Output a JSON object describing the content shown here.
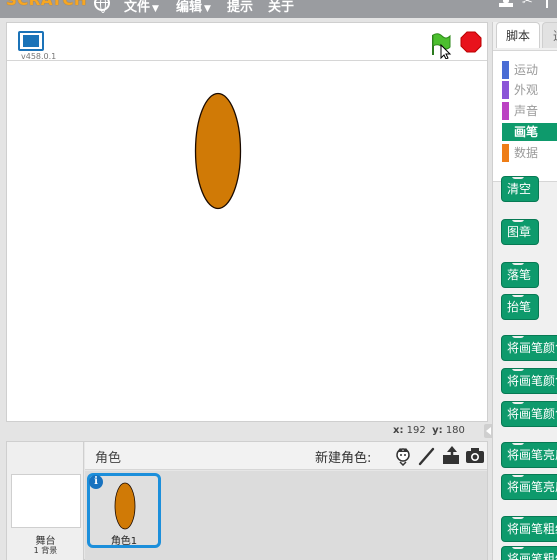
{
  "menubar": {
    "logo": "SCRATCH",
    "items": [
      {
        "label": "文件",
        "has_caret": true
      },
      {
        "label": "编辑",
        "has_caret": true
      },
      {
        "label": "提示",
        "has_caret": false
      },
      {
        "label": "关于",
        "has_caret": false
      }
    ],
    "caret": "▼",
    "tools": [
      "stamp-icon",
      "scissors-icon",
      "grow-icon"
    ]
  },
  "stage": {
    "version": "v458.0.1",
    "sprite_color": "#d07a06"
  },
  "coords": {
    "x_label": "x:",
    "x_value": "192",
    "y_label": "y:",
    "y_value": "180"
  },
  "sprites_panel": {
    "stage_label": "舞台",
    "backdrop_count": "1 背景",
    "title": "角色",
    "new_sprite_label": "新建角色:",
    "new_sprite_icons": [
      "sprite-library-icon",
      "paint-brush-icon",
      "upload-icon",
      "camera-icon"
    ],
    "sprites": [
      {
        "name": "角色1",
        "info": "i",
        "selected": true
      }
    ]
  },
  "palette": {
    "tabs": [
      {
        "label": "脚本",
        "active": true
      },
      {
        "label": "造型",
        "active": false
      }
    ],
    "categories": [
      {
        "label": "运动",
        "color": "#4a6cd4",
        "active": false
      },
      {
        "label": "外观",
        "color": "#8a55d7",
        "active": false
      },
      {
        "label": "声音",
        "color": "#bb42c3",
        "active": false
      },
      {
        "label": "画笔",
        "color": "#0e9a6c",
        "active": true
      },
      {
        "label": "数据",
        "color": "#ee7d16",
        "active": false
      }
    ],
    "blocks": [
      "清空",
      "图章",
      "落笔",
      "抬笔",
      "将画笔颜色",
      "将画笔颜色",
      "将画笔颜色",
      "将画笔亮度",
      "将画笔亮度",
      "将画笔粗细",
      "将画笔粗细"
    ]
  }
}
